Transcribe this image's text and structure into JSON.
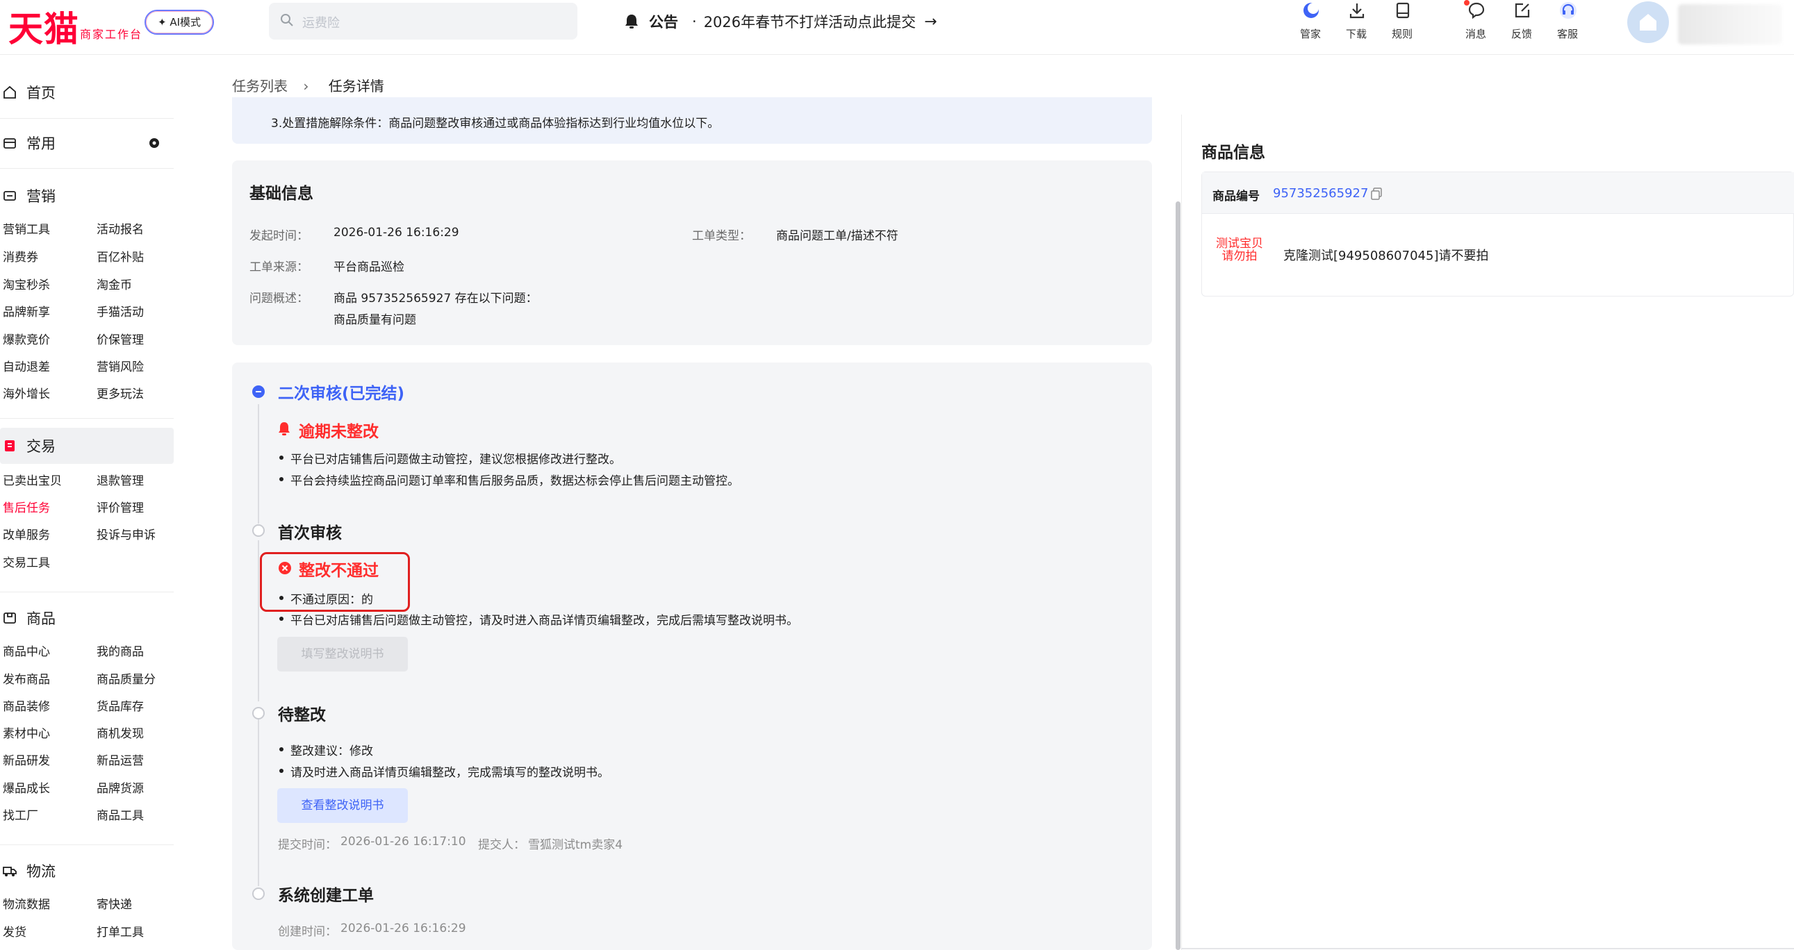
{
  "app": {
    "logo_text": "天猫",
    "logo_sub": "商家工作台",
    "ai_mode_label": "✦ AI模式"
  },
  "search": {
    "placeholder": "运费险"
  },
  "announcement": {
    "label": "公告",
    "separator": "·",
    "text": "2026年春节不打烊活动点此提交"
  },
  "toolbar": [
    {
      "label": "管家",
      "icon": "butler-icon"
    },
    {
      "label": "下载",
      "icon": "download-icon"
    },
    {
      "label": "规则",
      "icon": "rules-book-icon"
    },
    {
      "label": "消息",
      "icon": "message-icon"
    },
    {
      "label": "反馈",
      "icon": "feedback-icon"
    },
    {
      "label": "客服",
      "icon": "headset-icon"
    }
  ],
  "sidebar": {
    "home": "首页",
    "common": "常用",
    "sections": [
      {
        "title": "营销",
        "items": [
          "营销工具",
          "活动报名",
          "消费券",
          "百亿补贴",
          "淘宝秒杀",
          "淘金币",
          "品牌新享",
          "手猫活动",
          "爆款竞价",
          "价保管理",
          "自动退差",
          "营销风险",
          "海外增长",
          "更多玩法"
        ]
      },
      {
        "title": "交易",
        "items": [
          "已卖出宝贝",
          "退款管理",
          "售后任务",
          "评价管理",
          "改单服务",
          "投诉与申诉",
          "交易工具"
        ]
      },
      {
        "title": "商品",
        "items": [
          "商品中心",
          "我的商品",
          "发布商品",
          "商品质量分",
          "商品装修",
          "货品库存",
          "素材中心",
          "商机发现",
          "新品研发",
          "新品运营",
          "爆品成长",
          "品牌货源",
          "找工厂",
          "商品工具"
        ]
      },
      {
        "title": "物流",
        "items": [
          "物流数据",
          "寄快递",
          "发货",
          "打单工具"
        ]
      }
    ],
    "active_item": "售后任务"
  },
  "breadcrumb": {
    "parent": "任务列表",
    "separator": "›",
    "current": "任务详情"
  },
  "top_note": "3.处置措施解除条件：商品问题整改审核通过或商品体验指标达到行业均值水位以下。",
  "basic_info": {
    "title": "基础信息",
    "start_time_label": "发起时间：",
    "start_time": "2026-01-26 16:16:29",
    "order_type_label": "工单类型：",
    "order_type": "商品问题工单/描述不符",
    "source_label": "工单来源：",
    "source": "平台商品巡检",
    "summary_label": "问题概述：",
    "summary_line1": "商品 957352565927 存在以下问题：",
    "summary_line2": "商品质量有问题"
  },
  "timeline": {
    "second_review": {
      "title": "二次审核(已完结)",
      "status": "逾期未整改",
      "bullets": [
        "平台已对店铺售后问题做主动管控，建议您根据修改进行整改。",
        "平台会持续监控商品问题订单率和售后服务品质，数据达标会停止售后问题主动管控。"
      ]
    },
    "first_review": {
      "title": "首次审核",
      "status": "整改不通过",
      "bullets": [
        "不通过原因：的",
        "平台已对店铺售后问题做主动管控，请及时进入商品详情页编辑整改，完成后需填写整改说明书。"
      ],
      "button": "填写整改说明书"
    },
    "pending": {
      "title": "待整改",
      "bullets": [
        "整改建议：修改",
        "请及时进入商品详情页编辑整改，完成需填写的整改说明书。"
      ],
      "button": "查看整改说明书",
      "submit_time_label": "提交时间：",
      "submit_time": "2026-01-26 16:17:10",
      "submitter_label": "提交人：",
      "submitter": "雪狐测试tm卖家4"
    },
    "created": {
      "title": "系统创建工单",
      "create_time_label": "创建时间：",
      "create_time": "2026-01-26 16:16:29"
    }
  },
  "product_info": {
    "title": "商品信息",
    "id_label": "商品编号",
    "id": "957352565927",
    "thumb_text_line1": "测试宝贝",
    "thumb_text_line2": "请勿拍",
    "name": "克隆测试[949508607045]请不要拍"
  },
  "colors": {
    "brand_red": "#ff0036",
    "accent_blue": "#3e63f6",
    "alert_red": "#ff2d2d"
  }
}
